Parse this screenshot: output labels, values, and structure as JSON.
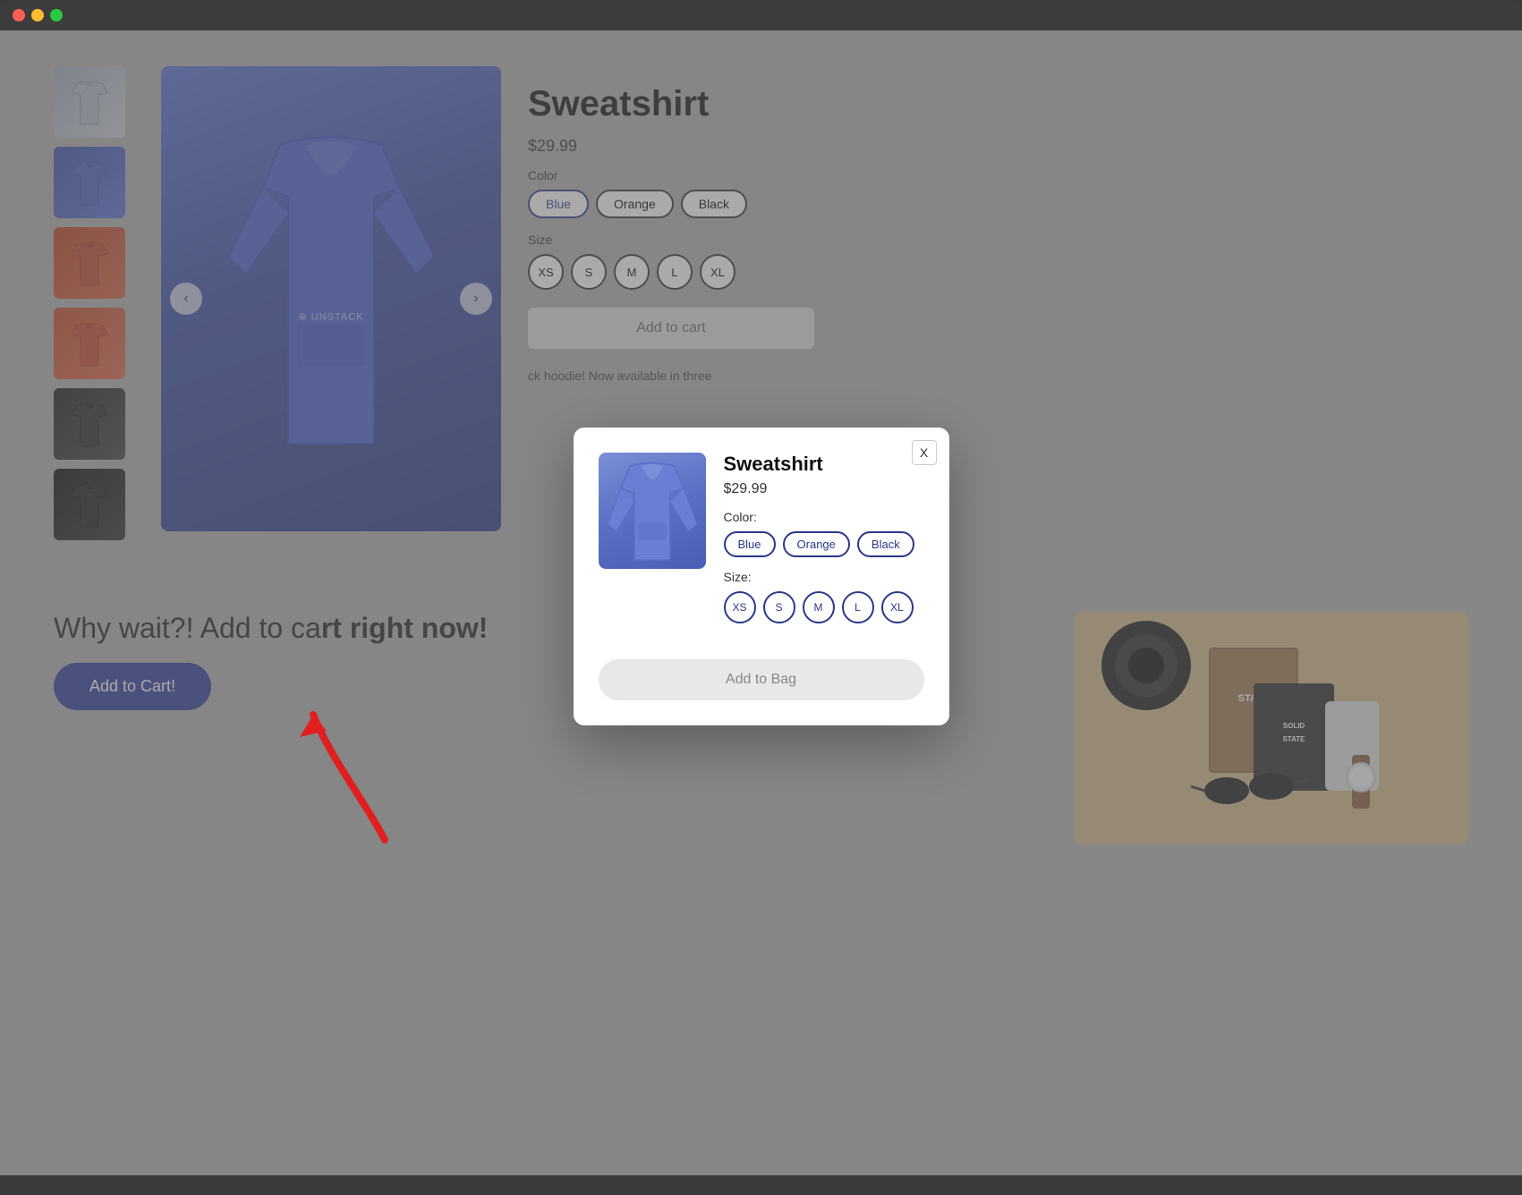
{
  "browser": {
    "traffic_lights": [
      "red",
      "yellow",
      "green"
    ]
  },
  "product": {
    "title": "Sweatshirt",
    "price": "$29.99",
    "color_label": "Color",
    "size_label": "Size",
    "colors": [
      "Blue",
      "Orange",
      "Black"
    ],
    "sizes": [
      "XS",
      "S",
      "M",
      "L",
      "XL"
    ],
    "add_to_cart_label": "Add to cart",
    "description": "ck hoodie! Now available in three"
  },
  "modal": {
    "product_name": "Sweatshirt",
    "product_price": "$29.99",
    "color_label": "Color:",
    "size_label": "Size:",
    "colors": [
      "Blue",
      "Orange",
      "Black"
    ],
    "sizes": [
      "XS",
      "S",
      "M",
      "L",
      "XL"
    ],
    "add_to_bag_label": "Add to Bag",
    "close_label": "X"
  },
  "cta": {
    "text_normal": "Why wait?! Add to ca",
    "text_bold": "right now!",
    "button_label": "Add to Cart!"
  },
  "thumbnails": [
    {
      "color": "gray",
      "label": "Gray hoodie thumbnail"
    },
    {
      "color": "blue",
      "label": "Blue hoodie thumbnail"
    },
    {
      "color": "orange",
      "label": "Orange hoodie thumbnail"
    },
    {
      "color": "orange2",
      "label": "Orange hoodie thumbnail 2"
    },
    {
      "color": "black",
      "label": "Black hoodie thumbnail"
    },
    {
      "color": "black2",
      "label": "Black hoodie thumbnail 2"
    }
  ]
}
